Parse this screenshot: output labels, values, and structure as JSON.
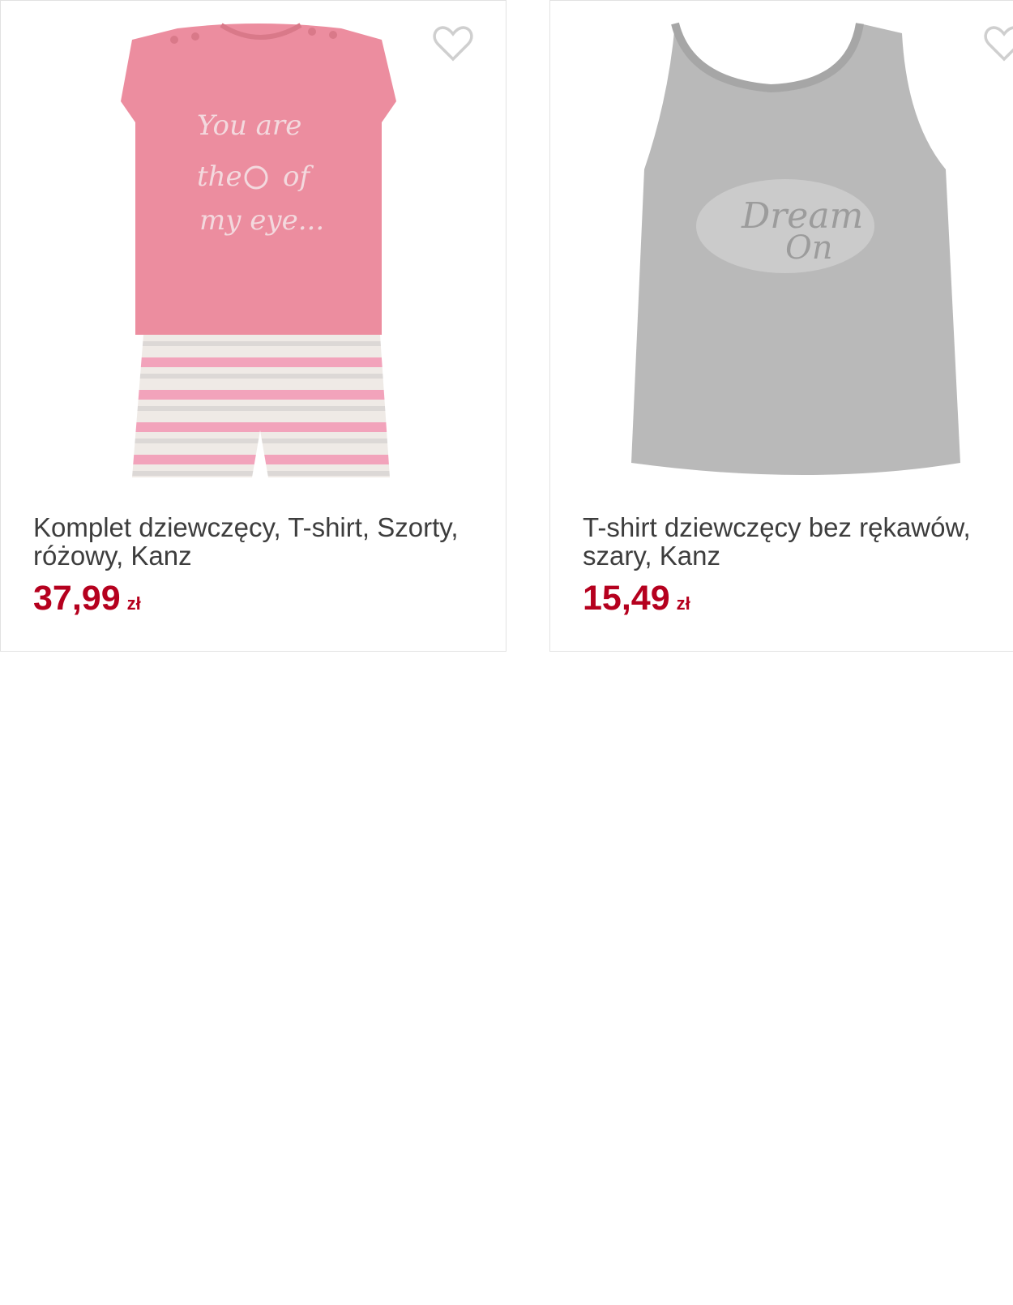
{
  "products": [
    {
      "name": "Komplet dziewczęcy, T-shirt, Szorty, różowy, Kanz",
      "price": "37,99",
      "currency": "zł",
      "wishlist_icon": "heart-outline-icon",
      "image_print_text": [
        "You are",
        "the",
        "of",
        "my eye..."
      ]
    },
    {
      "name": "T-shirt dziewczęcy bez rękawów, szary, Kanz",
      "price": "15,49",
      "currency": "zł",
      "wishlist_icon": "heart-outline-icon",
      "image_print_text": [
        "Dream",
        "On"
      ]
    }
  ],
  "colors": {
    "price": "#b5001e",
    "text": "#3d3d3d",
    "border": "#e2e2e2",
    "heart": "#cfcfcf"
  }
}
